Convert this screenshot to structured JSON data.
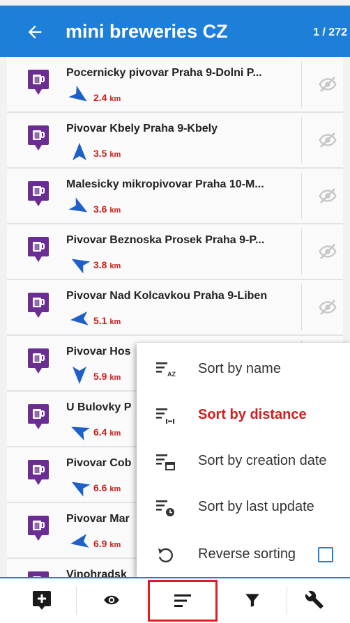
{
  "header": {
    "title": "mini breweries CZ",
    "count": "1 / 272"
  },
  "colors": {
    "accent": "#1e7fd8",
    "distance": "#d21d1d",
    "poi": "#6a2d91",
    "highlight": "#e01e1e"
  },
  "list": [
    {
      "name": "Pocernicky pivovar Praha 9-Dolni P...",
      "distance": "2.4",
      "unit": "km",
      "bearing_deg": 125
    },
    {
      "name": "Pivovar Kbely Praha 9-Kbely",
      "distance": "3.5",
      "unit": "km",
      "bearing_deg": 0
    },
    {
      "name": "Malesicky mikropivovar Praha 10-M...",
      "distance": "3.6",
      "unit": "km",
      "bearing_deg": 120
    },
    {
      "name": "Pivovar Beznoska Prosek Praha 9-P...",
      "distance": "3.8",
      "unit": "km",
      "bearing_deg": 300
    },
    {
      "name": "Pivovar Nad Kolcavkou Praha 9-Liben",
      "distance": "5.1",
      "unit": "km",
      "bearing_deg": 265
    },
    {
      "name": "Pivovar Hos",
      "distance": "5.9",
      "unit": "km",
      "bearing_deg": 180
    },
    {
      "name": "U Bulovky P",
      "distance": "6.4",
      "unit": "km",
      "bearing_deg": 295
    },
    {
      "name": "Pivovar Cob",
      "distance": "6.6",
      "unit": "km",
      "bearing_deg": 300
    },
    {
      "name": "Pivovar Mar",
      "distance": "6.9",
      "unit": "km",
      "bearing_deg": 260
    },
    {
      "name": "Vinohradsk",
      "distance": "",
      "unit": "",
      "bearing_deg": 0
    }
  ],
  "sort_menu": {
    "items": [
      {
        "label": "Sort by name",
        "icon": "sort-az-icon",
        "active": false
      },
      {
        "label": "Sort by distance",
        "icon": "sort-distance-icon",
        "active": true
      },
      {
        "label": "Sort by creation date",
        "icon": "sort-creation-date-icon",
        "active": false
      },
      {
        "label": "Sort by last update",
        "icon": "sort-last-update-icon",
        "active": false
      }
    ],
    "reverse": {
      "label": "Reverse sorting",
      "checked": false
    }
  },
  "bottom_bar": [
    "add-point-icon",
    "visibility-icon",
    "sort-icon",
    "filter-icon",
    "tools-icon"
  ]
}
